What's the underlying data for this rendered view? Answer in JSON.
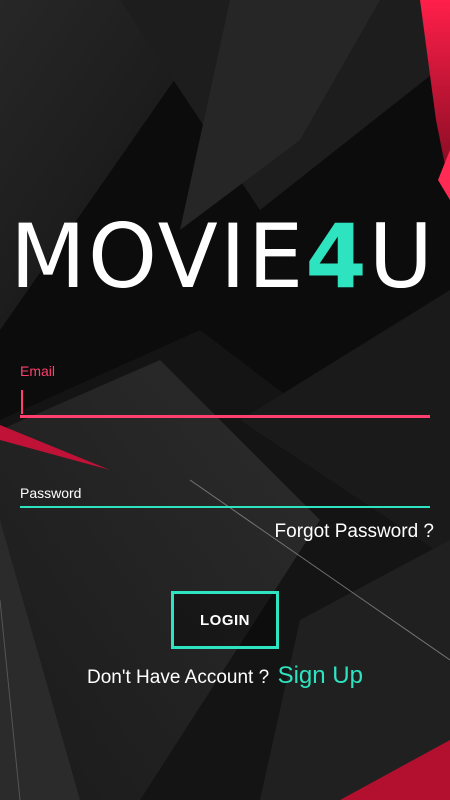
{
  "app": {
    "logo_main": "MOVIE",
    "logo_accent": "4",
    "logo_tail": "U"
  },
  "form": {
    "email_label": "Email",
    "email_value": "",
    "password_label": "Password",
    "password_value": "",
    "forgot_password": "Forgot Password ?",
    "login_button": "LOGIN",
    "signup_prompt": "Don't Have Account ?",
    "signup_link": "Sign Up"
  },
  "colors": {
    "accent_teal": "#2ee3c0",
    "accent_pink": "#ff3f6d",
    "background": "#0b0b0b"
  }
}
